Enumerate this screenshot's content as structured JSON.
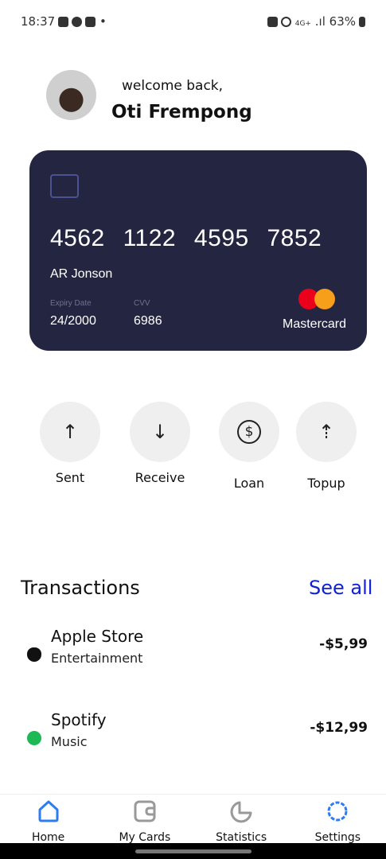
{
  "status": {
    "time": "18:37",
    "network": "4G+",
    "battery": "63%"
  },
  "header": {
    "welcome": "welcome back,",
    "name": "Oti Frempong"
  },
  "card": {
    "number": "4562 1122 4595 7852",
    "holder": "AR Jonson",
    "expiry_label": "Expiry Date",
    "expiry": "24/2000",
    "cvv_label": "CVV",
    "cvv": "6986",
    "brand": "Mastercard",
    "colors": {
      "bg": "#242641",
      "red": "#eb001b",
      "orange": "#f79e1b"
    }
  },
  "actions": [
    {
      "label": "Sent",
      "icon": "arrow-up-icon"
    },
    {
      "label": "Receive",
      "icon": "arrow-down-icon"
    },
    {
      "label": "Loan",
      "icon": "dollar-icon"
    },
    {
      "label": "Topup",
      "icon": "cloud-upload-icon"
    }
  ],
  "transactions": {
    "title": "Transactions",
    "see_all": "See all",
    "items": [
      {
        "name": "Apple Store",
        "category": "Entertainment",
        "amount": "-$5,99"
      },
      {
        "name": "Spotify",
        "category": "Music",
        "amount": "-$12,99"
      }
    ]
  },
  "nav": [
    {
      "label": "Home",
      "active": true
    },
    {
      "label": "My Cards"
    },
    {
      "label": "Statistics"
    },
    {
      "label": "Settings",
      "active": true
    }
  ]
}
